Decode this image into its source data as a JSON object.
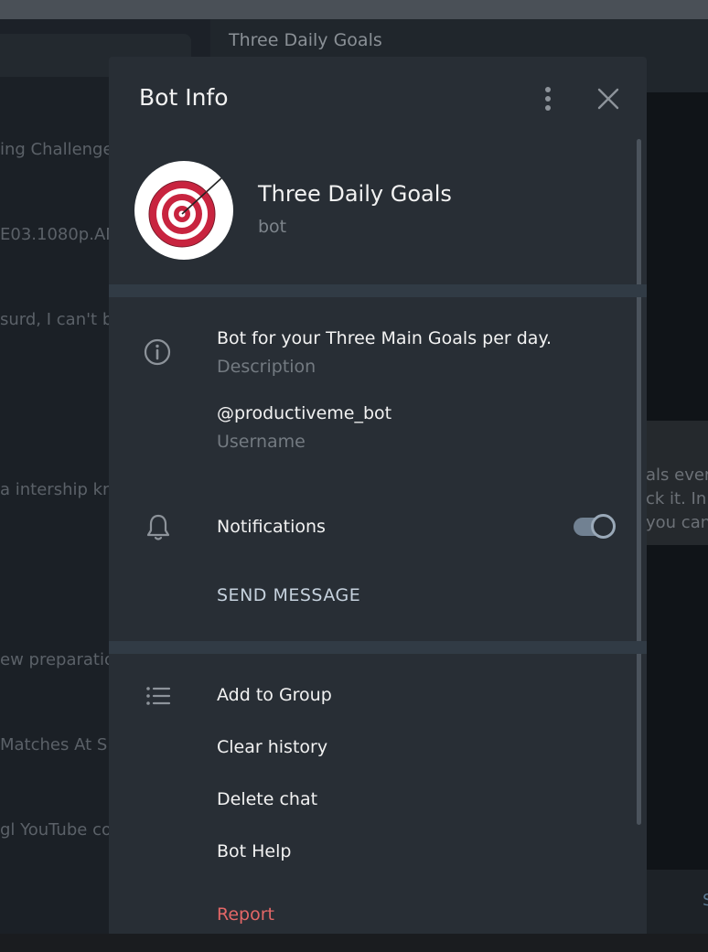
{
  "background": {
    "chat_list_items": [
      "ing Challenge",
      "E03.1080p.AM",
      "surd, I can't be",
      "a intership kn",
      "ew preparatio",
      "Matches At S",
      "gl YouTube co"
    ],
    "chat_header_title": "Three Daily Goals",
    "message_lines": [
      "als ever",
      "ck it. In",
      "you can"
    ],
    "input_fragment": "S"
  },
  "modal": {
    "title": "Bot Info",
    "profile": {
      "name": "Three Daily Goals",
      "subtitle": "bot",
      "avatar_icon": "target-icon"
    },
    "info": {
      "description_value": "Bot for your Three Main Goals per day.",
      "description_label": "Description",
      "username_value": "@productiveme_bot",
      "username_label": "Username"
    },
    "notifications": {
      "label": "Notifications",
      "enabled": true
    },
    "send_message": "SEND MESSAGE",
    "actions": {
      "add_to_group": "Add to Group",
      "clear_history": "Clear history",
      "delete_chat": "Delete chat",
      "bot_help": "Bot Help",
      "report": "Report"
    },
    "colors": {
      "panel": "#282e35",
      "accent": "#c6d2de",
      "danger": "#e36767",
      "toggle": "#718192"
    }
  }
}
